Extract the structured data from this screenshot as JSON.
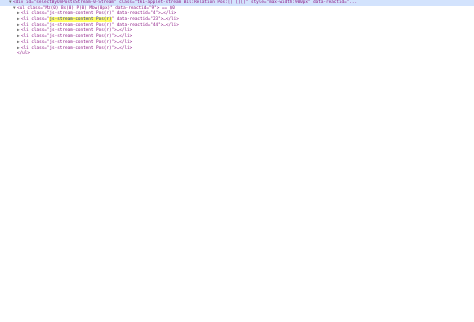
{
  "colors": {
    "selected_row": "#d3e3fd",
    "tag": "#881280",
    "attr_name": "#994500",
    "attr_value": "#1a1aa6",
    "highlight": "#ffff66"
  },
  "lines": [
    {
      "twisty": "▼",
      "text": "<div id=\"selectByOnPostsStream-0-Stream\" class=\"tk1-applet-stream Bil:Relation Pos:[] [][]\" style=\"max-width:900px\" data-reactid=\"...",
      "selected": true,
      "indent": 0
    },
    {
      "twisty": "▼",
      "text": "<ul class=\"Mz(0) Bs(0) P(0) Mbw(0px)\" data-reactid=\"9\"> == $0",
      "selected": false,
      "indent": 1
    },
    {
      "twisty": "▶",
      "text": "<li class=\"js-stream-content Pos(r)\" data-reactid=\"4\">…</li>",
      "selected": false,
      "indent": 2
    },
    {
      "twisty": "▶",
      "pre": "<li class=\"",
      "highlight": "js-stream-content Pos(r)",
      "post": "\" data-reactid=\"23\">…</li>",
      "selected": false,
      "indent": 2
    },
    {
      "twisty": "▶",
      "text": "<li class=\"js-stream-content Pos(r)\" data-reactid=\"44\">…</li>",
      "selected": false,
      "indent": 2
    },
    {
      "twisty": "▶",
      "text": "<li class=\"js-stream-content Pos(r)\">…</li>",
      "selected": false,
      "indent": 2
    },
    {
      "twisty": "▶",
      "text": "<li class=\"js-stream-content Pos(r)\">…</li>",
      "selected": false,
      "indent": 2
    },
    {
      "twisty": "▶",
      "text": "<li class=\"js-stream-content Pos(r)\">…</li>",
      "selected": false,
      "indent": 2
    },
    {
      "twisty": "▶",
      "text": "<li class=\"js-stream-content Pos(r)\">…</li>",
      "selected": false,
      "indent": 2
    },
    {
      "twisty": "",
      "text": "</ul>",
      "selected": false,
      "indent": 1
    }
  ]
}
